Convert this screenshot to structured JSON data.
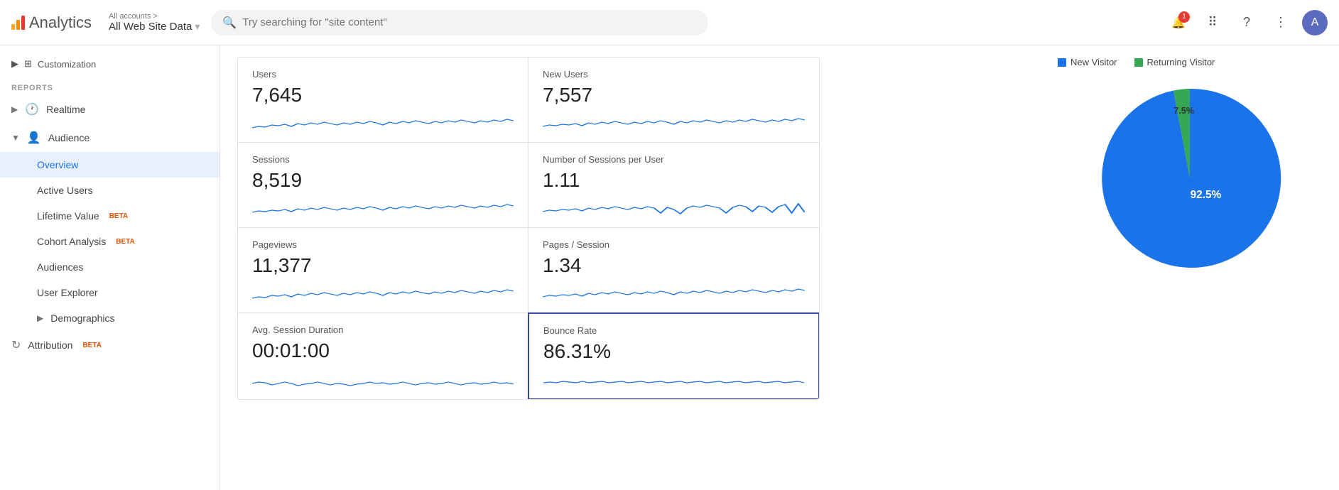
{
  "header": {
    "app_name": "Analytics",
    "breadcrumb_parent": "All accounts >",
    "account_name": "All Web Site Data",
    "search_placeholder": "Try searching for \"site content\"",
    "notif_count": "1"
  },
  "sidebar": {
    "customization_label": "Customization",
    "reports_label": "REPORTS",
    "items": [
      {
        "id": "realtime",
        "label": "Realtime",
        "icon": "clock",
        "indent": false,
        "active": false
      },
      {
        "id": "audience",
        "label": "Audience",
        "icon": "person",
        "indent": false,
        "active": false,
        "expanded": true
      },
      {
        "id": "overview",
        "label": "Overview",
        "icon": "",
        "indent": true,
        "active": true
      },
      {
        "id": "active-users",
        "label": "Active Users",
        "icon": "",
        "indent": true,
        "active": false
      },
      {
        "id": "lifetime-value",
        "label": "Lifetime Value",
        "icon": "",
        "indent": true,
        "active": false,
        "beta": true
      },
      {
        "id": "cohort-analysis",
        "label": "Cohort Analysis",
        "icon": "",
        "indent": true,
        "active": false,
        "beta": true
      },
      {
        "id": "audiences",
        "label": "Audiences",
        "icon": "",
        "indent": true,
        "active": false
      },
      {
        "id": "user-explorer",
        "label": "User Explorer",
        "icon": "",
        "indent": true,
        "active": false
      },
      {
        "id": "demographics",
        "label": "Demographics",
        "icon": "",
        "indent": true,
        "active": false,
        "expandable": true
      },
      {
        "id": "attribution",
        "label": "Attribution",
        "icon": "loop",
        "indent": false,
        "active": false,
        "beta": true
      }
    ]
  },
  "metrics": [
    {
      "id": "users",
      "label": "Users",
      "value": "7,645",
      "highlighted": false
    },
    {
      "id": "new-users",
      "label": "New Users",
      "value": "7,557",
      "highlighted": false
    },
    {
      "id": "sessions",
      "label": "Sessions",
      "value": "8,519",
      "highlighted": false
    },
    {
      "id": "sessions-per-user",
      "label": "Number of Sessions per User",
      "value": "1.11",
      "highlighted": false
    },
    {
      "id": "pageviews",
      "label": "Pageviews",
      "value": "11,377",
      "highlighted": false
    },
    {
      "id": "pages-session",
      "label": "Pages / Session",
      "value": "1.34",
      "highlighted": false
    },
    {
      "id": "avg-session",
      "label": "Avg. Session Duration",
      "value": "00:01:00",
      "highlighted": false
    },
    {
      "id": "bounce-rate",
      "label": "Bounce Rate",
      "value": "86.31%",
      "highlighted": true
    }
  ],
  "chart": {
    "legend": {
      "new_visitor_label": "New Visitor",
      "returning_visitor_label": "Returning Visitor"
    },
    "new_pct": 92.5,
    "returning_pct": 7.5,
    "new_label": "92.5%",
    "returning_label": "7.5%",
    "new_color": "#1a73e8",
    "returning_color": "#34a853"
  }
}
